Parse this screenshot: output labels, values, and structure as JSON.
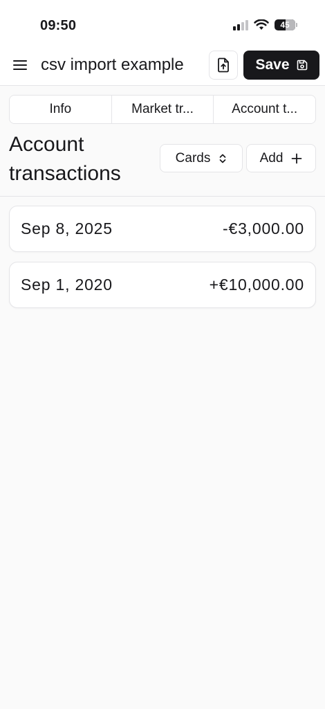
{
  "status_bar": {
    "time": "09:50",
    "battery_level": "45",
    "icons": [
      "signal-icon",
      "wifi-icon",
      "battery-icon"
    ]
  },
  "header": {
    "title": "csv import example",
    "import_icon": "file-upload-icon",
    "save_label": "Save",
    "save_icon": "floppy-disk-icon"
  },
  "tabs": [
    {
      "label": "Info"
    },
    {
      "label": "Market tr..."
    },
    {
      "label": "Account t..."
    }
  ],
  "section": {
    "title": "Account transactions",
    "view_select_label": "Cards",
    "add_label": "Add"
  },
  "transactions": [
    {
      "date": "Sep 8, 2025",
      "amount": "-€3,000.00"
    },
    {
      "date": "Sep 1, 2020",
      "amount": "+€10,000.00"
    }
  ],
  "colors": {
    "primary": "#18181b",
    "border": "#e4e4e7",
    "background": "#fafafa"
  }
}
